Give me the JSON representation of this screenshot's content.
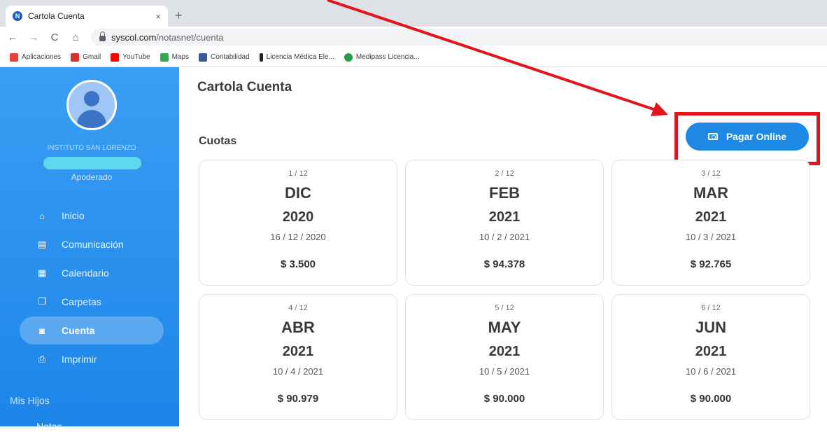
{
  "browser": {
    "tab_title": "Cartola Cuenta",
    "tab_close": "×",
    "new_tab": "+",
    "url_domain": "syscol.com",
    "url_path": "/notasnet/cuenta",
    "bookmarks": [
      {
        "label": "Aplicaciones",
        "color": "#e94235"
      },
      {
        "label": "Gmail",
        "color": "#d93025"
      },
      {
        "label": "YouTube",
        "color": "#ff0000"
      },
      {
        "label": "Maps",
        "color": "#34a853"
      },
      {
        "label": "Contabilidad",
        "color": "#3b5998"
      },
      {
        "label": "Licencia Médica Ele...",
        "color": "#222222"
      },
      {
        "label": "Medipass Licencia...",
        "color": "#1e9c4a"
      }
    ]
  },
  "sidebar": {
    "school": "INSTITUTO SAN LORENZO",
    "role": "Apoderado",
    "items": [
      {
        "label": "Inicio",
        "icon": "home-icon",
        "glyph": "⌂"
      },
      {
        "label": "Comunicación",
        "icon": "message-icon",
        "glyph": "▤"
      },
      {
        "label": "Calendario",
        "icon": "calendar-icon",
        "glyph": "▦"
      },
      {
        "label": "Carpetas",
        "icon": "folder-icon",
        "glyph": "❐"
      },
      {
        "label": "Cuenta",
        "icon": "cash-icon",
        "glyph": "◙"
      },
      {
        "label": "Imprimir",
        "icon": "print-icon",
        "glyph": "⎙"
      }
    ],
    "section_label": "Mis Hijos",
    "notas_label": "Notas"
  },
  "main": {
    "title": "Cartola Cuenta",
    "section_title": "Cuotas",
    "pay_button": "Pagar Online",
    "cuotas": [
      {
        "num": "1 / 12",
        "month": "DIC",
        "year": "2020",
        "date": "16 / 12 / 2020",
        "amount": "$ 3.500"
      },
      {
        "num": "2 / 12",
        "month": "FEB",
        "year": "2021",
        "date": "10 / 2 / 2021",
        "amount": "$ 94.378"
      },
      {
        "num": "3 / 12",
        "month": "MAR",
        "year": "2021",
        "date": "10 / 3 / 2021",
        "amount": "$ 92.765"
      },
      {
        "num": "4 / 12",
        "month": "ABR",
        "year": "2021",
        "date": "10 / 4 / 2021",
        "amount": "$ 90.979"
      },
      {
        "num": "5 / 12",
        "month": "MAY",
        "year": "2021",
        "date": "10 / 5 / 2021",
        "amount": "$ 90.000"
      },
      {
        "num": "6 / 12",
        "month": "JUN",
        "year": "2021",
        "date": "10 / 6 / 2021",
        "amount": "$ 90.000"
      }
    ]
  },
  "colors": {
    "accent": "#1e88e5",
    "highlight": "#e3141b"
  }
}
